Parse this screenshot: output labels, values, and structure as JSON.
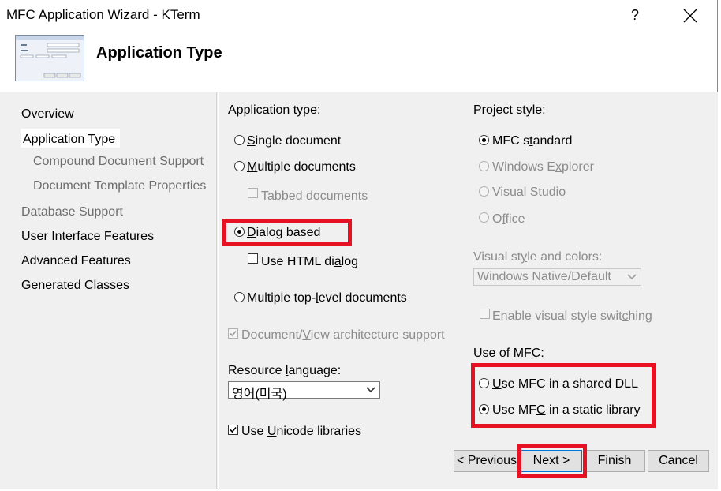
{
  "window": {
    "title": "MFC Application Wizard - KTerm",
    "help_glyph": "?"
  },
  "header": {
    "title": "Application Type"
  },
  "nav": {
    "items": [
      {
        "label": "Overview"
      },
      {
        "label": "Application Type"
      },
      {
        "label": "Compound Document Support"
      },
      {
        "label": "Document Template Properties"
      },
      {
        "label": "Database Support"
      },
      {
        "label": "User Interface Features"
      },
      {
        "label": "Advanced Features"
      },
      {
        "label": "Generated Classes"
      }
    ]
  },
  "app_type": {
    "heading": "Application type:",
    "single": {
      "key": "S",
      "rest": "ingle document"
    },
    "multiple": {
      "key": "M",
      "rest": "ultiple documents"
    },
    "tabbed": {
      "pre": "Ta",
      "key": "b",
      "rest": "bed documents"
    },
    "dialog": {
      "key": "D",
      "rest": "ialog based"
    },
    "html_dialog": {
      "pre": "Use HTML di",
      "key": "a",
      "rest": "log"
    },
    "top_level": {
      "pre": "Multiple top-",
      "key": "l",
      "rest": "evel documents"
    },
    "docview": {
      "pre": "Document/",
      "key": "V",
      "rest": "iew architecture support"
    }
  },
  "resource": {
    "heading_pre": "Resource ",
    "heading_key": "l",
    "heading_rest": "anguage:",
    "selected": "영어(미국)"
  },
  "unicode": {
    "pre": "Use ",
    "key": "U",
    "rest": "nicode libraries"
  },
  "project_style": {
    "heading": "Project style:",
    "mfc_standard": {
      "pre": "MFC s",
      "key": "t",
      "rest": "andard"
    },
    "windows_explorer": {
      "pre": "Windows E",
      "key": "x",
      "rest": "plorer"
    },
    "visual_studio": {
      "pre": "Visual Studi",
      "key": "o",
      "rest": ""
    },
    "office": {
      "pre": "O",
      "key": "f",
      "rest": "fice"
    }
  },
  "visual_style": {
    "heading_pre": "Visual st",
    "heading_key": "y",
    "heading_rest": "le and colors:",
    "selected": "Windows Native/Default"
  },
  "style_switching": {
    "pre": "Enable visual style swit",
    "key": "c",
    "rest": "hing"
  },
  "mfc_use": {
    "heading": "Use of MFC:",
    "shared": {
      "key": "U",
      "rest": "se MFC in a shared DLL"
    },
    "static": {
      "pre": "Use MF",
      "key": "C",
      "rest": " in a static library"
    }
  },
  "buttons": {
    "previous": "< Previous",
    "next": "Next >",
    "finish": "Finish",
    "cancel": "Cancel"
  },
  "colors": {
    "highlight": "#e81123"
  }
}
